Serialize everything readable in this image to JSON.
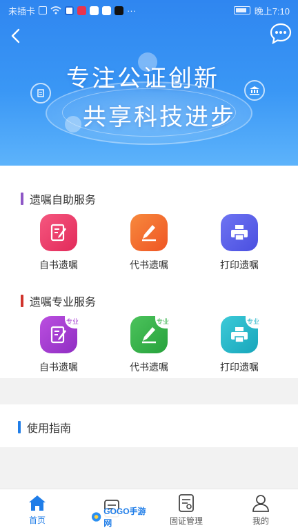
{
  "status_bar": {
    "carrier": "未插卡",
    "more": "···",
    "time": "晚上7:10"
  },
  "hero": {
    "line1": "专注公证创新",
    "line2": "共享科技进步"
  },
  "self_service": {
    "title": "遗嘱自助服务",
    "accent": "#8e57c6",
    "items": [
      {
        "label": "自书遗嘱",
        "icon": "write-will-icon",
        "color": "#ee3e6e"
      },
      {
        "label": "代书遗嘱",
        "icon": "proxy-write-icon",
        "color": "#f36a2e"
      },
      {
        "label": "打印遗嘱",
        "icon": "printer-icon",
        "color": "#5b61e8"
      }
    ]
  },
  "pro_service": {
    "title": "遗嘱专业服务",
    "accent": "#d0342c",
    "badge": "专业",
    "items": [
      {
        "label": "自书遗嘱",
        "icon": "write-will-icon",
        "color": "#a43bd0"
      },
      {
        "label": "代书遗嘱",
        "icon": "proxy-write-icon",
        "color": "#36b24a"
      },
      {
        "label": "打印遗嘱",
        "icon": "printer-icon",
        "color": "#22b4c8"
      }
    ]
  },
  "guide": {
    "title": "使用指南",
    "accent": "#1f7de8"
  },
  "bottom_nav": {
    "items": [
      {
        "label": "首页",
        "icon": "home-icon",
        "active": true
      },
      {
        "label": "",
        "icon": "document-icon",
        "active": false
      },
      {
        "label": "固证管理",
        "icon": "evidence-doc-icon",
        "active": false
      },
      {
        "label": "我的",
        "icon": "user-icon",
        "active": false
      }
    ]
  },
  "watermark": {
    "text": "GOGO手游网"
  },
  "colors": {
    "primary": "#1f7de8",
    "hero_top": "#2f86f0",
    "hero_bottom": "#5db3fb"
  }
}
